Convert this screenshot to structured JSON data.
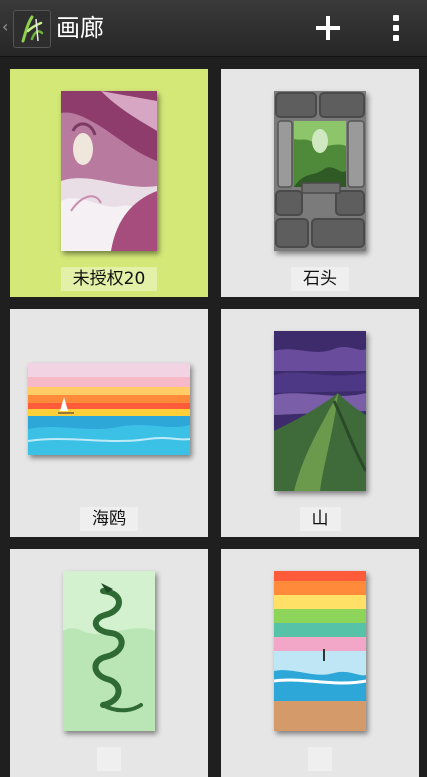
{
  "actionbar": {
    "title": "画廊",
    "icons": {
      "up": "back-caret-icon",
      "app": "app-logo-icon",
      "add": "plus-icon",
      "overflow": "overflow-menu-icon"
    }
  },
  "gallery": {
    "items": [
      {
        "label": "未授权20",
        "selected": true,
        "art": "pink-haired-woman"
      },
      {
        "label": "石头",
        "selected": false,
        "art": "stone-window-forest"
      },
      {
        "label": "海鸥",
        "selected": false,
        "art": "sunset-sea"
      },
      {
        "label": "山",
        "selected": false,
        "art": "purple-sky-mountain"
      },
      {
        "label": "",
        "selected": false,
        "art": "green-dragon"
      },
      {
        "label": "",
        "selected": false,
        "art": "rainbow-beach"
      }
    ]
  },
  "colors": {
    "selected_tile": "#d4e878",
    "tile": "#e6e6e6",
    "background": "#1f1f1f"
  }
}
